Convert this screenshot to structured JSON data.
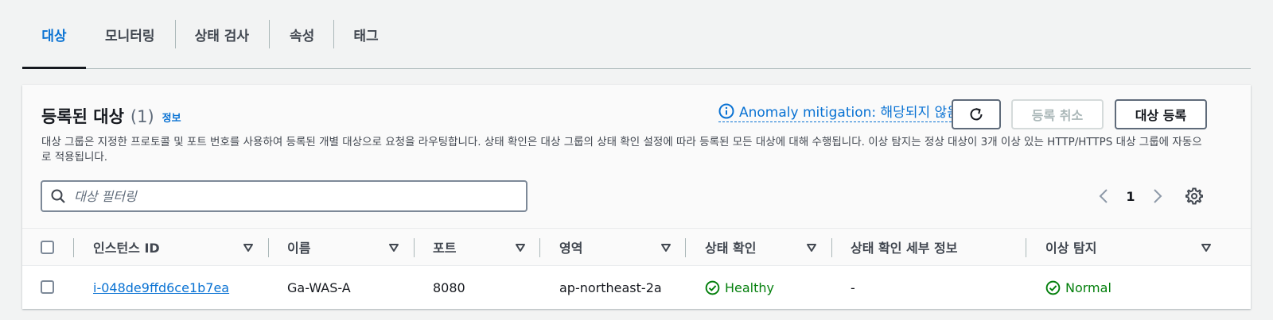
{
  "tabs": [
    {
      "label": "대상",
      "active": true
    },
    {
      "label": "모니터링"
    },
    {
      "label": "상태 검사"
    },
    {
      "label": "속성"
    },
    {
      "label": "태그"
    }
  ],
  "header": {
    "title": "등록된 대상",
    "count": "(1)",
    "info_label": "정보",
    "anomaly_label": "Anomaly mitigation: 해당되지 않음",
    "deregister_label": "등록 취소",
    "register_label": "대상 등록",
    "description": "대상 그룹은 지정한 프로토콜 및 포트 번호를 사용하여 등록된 개별 대상으로 요청을 라우팅합니다. 상태 확인은 대상 그룹의 상태 확인 설정에 따라 등록된 모든 대상에 대해 수행됩니다. 이상 탐지는 정상 대상이 3개 이상 있는 HTTP/HTTPS 대상 그룹에 자동으로 적용됩니다."
  },
  "filter": {
    "placeholder": "대상 필터링"
  },
  "pagination": {
    "current_page": "1"
  },
  "table": {
    "columns": [
      "인스턴스 ID",
      "이름",
      "포트",
      "영역",
      "상태 확인",
      "상태 확인 세부 정보",
      "이상 탐지"
    ],
    "rows": [
      {
        "instance_id": "i-048de9ffd6ce1b7ea",
        "name": "Ga-WAS-A",
        "port": "8080",
        "zone": "ap-northeast-2a",
        "health": "Healthy",
        "health_details": "-",
        "anomaly": "Normal"
      }
    ]
  },
  "colors": {
    "accent": "#0972d3",
    "success": "#037f0c",
    "text": "#16191f",
    "muted": "#5f6b7a"
  },
  "icons": [
    "info-icon",
    "refresh-icon",
    "search-icon",
    "chevron-left-icon",
    "chevron-right-icon",
    "gear-icon",
    "sort-down-icon",
    "check-circle-icon"
  ]
}
